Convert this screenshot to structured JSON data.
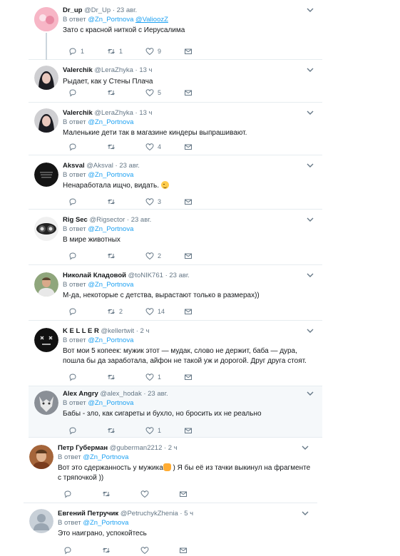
{
  "tweets": [
    {
      "name": "Dr_up",
      "handle": "@Dr_Up",
      "time": "· 23 авг.",
      "reply_prefix": "В ответ",
      "reply_to": "@Zn_Portnova",
      "reply_to_2": "@ValioozZ",
      "text": "Зато с красной ниткой с Иерусалима",
      "replies": "1",
      "retweets": "1",
      "likes": "9"
    },
    {
      "name": "Valerchik",
      "handle": "@LeraZhyka",
      "time": "· 13 ч",
      "text": "Рыдает, как у Стены Плача",
      "replies": "",
      "retweets": "",
      "likes": "5"
    },
    {
      "name": "Valerchik",
      "handle": "@LeraZhyka",
      "time": "· 13 ч",
      "reply_prefix": "В ответ",
      "reply_to": "@Zn_Portnova",
      "text": "Маленькие дети так в магазине киндеры выпрашивают.",
      "replies": "",
      "retweets": "",
      "likes": "4"
    },
    {
      "name": "Aksval",
      "handle": "@Aksval",
      "time": "· 23 авг.",
      "reply_prefix": "В ответ",
      "reply_to": "@Zn_Portnova",
      "text": "Ненаработала ищчо, видать.",
      "replies": "",
      "retweets": "",
      "likes": "3"
    },
    {
      "name": "Rig Sec",
      "handle": "@Rigsector",
      "time": "· 23 авг.",
      "reply_prefix": "В ответ",
      "reply_to": "@Zn_Portnova",
      "text": "В мире животных",
      "replies": "",
      "retweets": "",
      "likes": "2"
    },
    {
      "name": "Николай Кладовой",
      "handle": "@toNIK761",
      "time": "· 23 авг.",
      "reply_prefix": "В ответ",
      "reply_to": "@Zn_Portnova",
      "text": "М-да, некоторые с детства, вырастают только в размерах))",
      "replies": "",
      "retweets": "2",
      "likes": "14"
    },
    {
      "name": "K E L L E R",
      "handle": "@kellertwit",
      "time": "· 2 ч",
      "reply_prefix": "В ответ",
      "reply_to": "@Zn_Portnova",
      "text": "Вот мои 5 копеек: мужик этот — мудак, слово не держит, баба — дура, пошла бы да заработала, айфон не такой уж и дорогой. Друг друга стоят.",
      "replies": "",
      "retweets": "",
      "likes": "1"
    },
    {
      "name": "Alex Angry",
      "handle": "@alex_hodak",
      "time": "· 23 авг.",
      "reply_prefix": "В ответ",
      "reply_to": "@Zn_Portnova",
      "text": "Бабы - зло, как сигареты и бухло, но бросить их не реально",
      "replies": "",
      "retweets": "",
      "likes": "1"
    },
    {
      "name": "Петр Губерман",
      "handle": "@guberman2212",
      "time": "· 2 ч",
      "reply_prefix": "В ответ",
      "reply_to": "@Zn_Portnova",
      "text_a": "Вот это сдержанность у мужика",
      "text_b": " ) Я бы её из тачки выкинул на фрагменте с тряпочкой ))",
      "replies": "",
      "retweets": "",
      "likes": ""
    },
    {
      "name": "Евгений Петручик",
      "handle": "@PetruchykZhenia",
      "time": "· 5 ч",
      "reply_prefix": "В ответ",
      "reply_to": "@Zn_Portnova",
      "text": "Это наиграно, успокойтесь",
      "replies": "",
      "retweets": "",
      "likes": ""
    }
  ],
  "colors": {
    "link": "#1da1f2",
    "muted": "#657786",
    "border": "#e6ecf0",
    "selected_bg": "#f5f8fa"
  }
}
